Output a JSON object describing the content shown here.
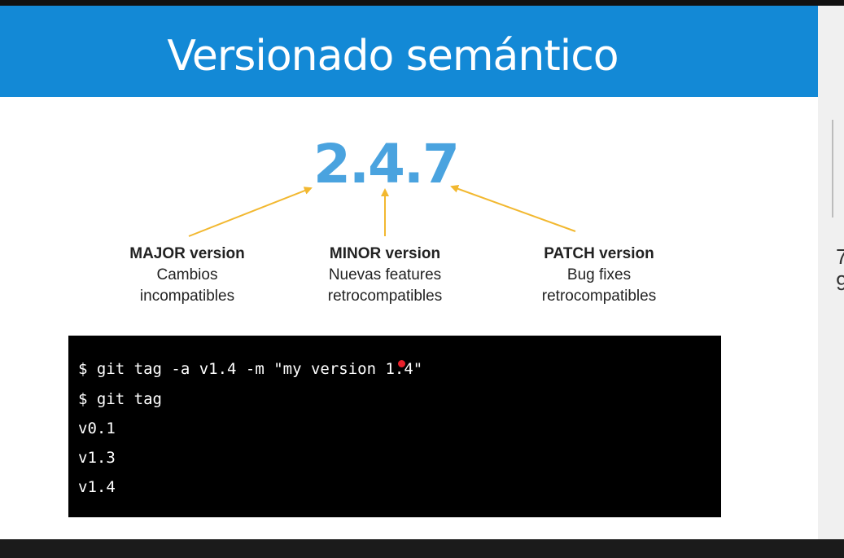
{
  "slide": {
    "title": "Versionado semántico",
    "version_number": "2.4.7",
    "labels": {
      "major": {
        "heading": "MAJOR version",
        "line1": "Cambios",
        "line2": "incompatibles"
      },
      "minor": {
        "heading": "MINOR version",
        "line1": "Nuevas features",
        "line2": "retrocompatibles"
      },
      "patch": {
        "heading": "PATCH version",
        "line1": "Bug fixes",
        "line2": "retrocompatibles"
      }
    },
    "terminal_lines": [
      "$ git tag -a v1.4 -m \"my version 1.4\"",
      "$ git tag",
      "v0.1",
      "v1.3",
      "v1.4"
    ]
  },
  "side_panel": {
    "glyph_top": "7",
    "glyph_bottom": "9"
  },
  "colors": {
    "header_blue": "#1389d6",
    "version_blue": "#4aa3df",
    "arrow_yellow": "#f2b830",
    "cursor_red": "#e8202a"
  }
}
